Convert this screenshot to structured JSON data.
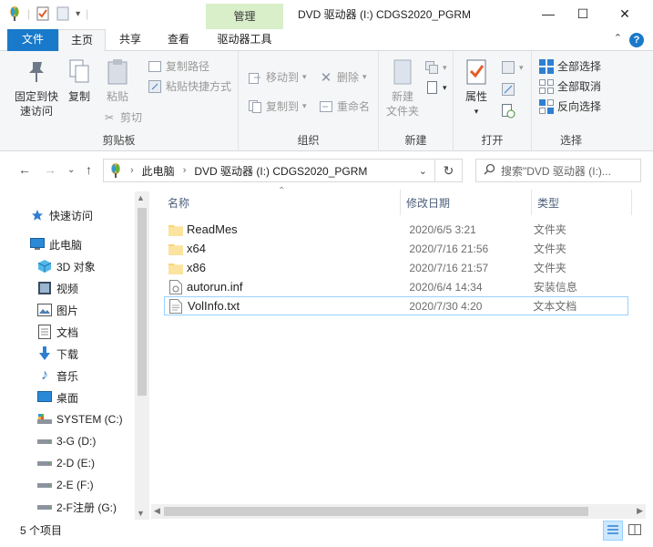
{
  "window": {
    "title": "DVD 驱动器 (I:) CDGS2020_PGRM",
    "context_tab_group": "管理",
    "controls": {
      "minimize": "—",
      "maximize": "☐",
      "close": "✕"
    }
  },
  "tabs": [
    "文件",
    "主页",
    "共享",
    "查看",
    "驱动器工具"
  ],
  "help_label": "?",
  "ribbon": {
    "clipboard": {
      "label": "剪贴板",
      "pin": "固定到快\n速访问",
      "copy": "复制",
      "paste": "粘贴",
      "copy_path": "复制路径",
      "paste_shortcut": "粘贴快捷方式",
      "cut": "剪切"
    },
    "organize": {
      "label": "组织",
      "move_to": "移动到",
      "copy_to": "复制到",
      "delete": "删除",
      "rename": "重命名"
    },
    "new": {
      "label": "新建",
      "new_folder": "新建\n文件夹"
    },
    "open": {
      "label": "打开",
      "properties": "属性"
    },
    "select": {
      "label": "选择",
      "select_all": "全部选择",
      "select_none": "全部取消",
      "invert": "反向选择"
    }
  },
  "address": {
    "crumbs": [
      "此电脑",
      "DVD 驱动器 (I:) CDGS2020_PGRM"
    ],
    "search_placeholder": "搜索\"DVD 驱动器 (I:)..."
  },
  "nav": {
    "quick_access": "快速访问",
    "this_pc": "此电脑",
    "items": [
      {
        "label": "3D 对象",
        "icon": "cube-icon"
      },
      {
        "label": "视频",
        "icon": "video-icon"
      },
      {
        "label": "图片",
        "icon": "pictures-icon"
      },
      {
        "label": "文档",
        "icon": "documents-icon"
      },
      {
        "label": "下载",
        "icon": "download-icon"
      },
      {
        "label": "音乐",
        "icon": "music-icon"
      },
      {
        "label": "桌面",
        "icon": "desktop-icon"
      },
      {
        "label": "SYSTEM (C:)",
        "icon": "system-drive-icon"
      },
      {
        "label": "3-G (D:)",
        "icon": "drive-icon"
      },
      {
        "label": "2-D (E:)",
        "icon": "drive-icon"
      },
      {
        "label": "2-E (F:)",
        "icon": "drive-icon"
      },
      {
        "label": "2-F注册 (G:)",
        "icon": "drive-icon"
      }
    ]
  },
  "columns": [
    "名称",
    "修改日期",
    "类型"
  ],
  "files": [
    {
      "name": "ReadMes",
      "date": "2020/6/5 3:21",
      "type": "文件夹",
      "icon": "folder-icon"
    },
    {
      "name": "x64",
      "date": "2020/7/16 21:56",
      "type": "文件夹",
      "icon": "folder-icon"
    },
    {
      "name": "x86",
      "date": "2020/7/16 21:57",
      "type": "文件夹",
      "icon": "folder-icon"
    },
    {
      "name": "autorun.inf",
      "date": "2020/6/4 14:34",
      "type": "安装信息",
      "icon": "inf-file-icon"
    },
    {
      "name": "VolInfo.txt",
      "date": "2020/7/30 4:20",
      "type": "文本文档",
      "icon": "text-file-icon",
      "selected": true
    }
  ],
  "status": {
    "item_count": "5 个项目"
  },
  "colors": {
    "accent": "#1979ca",
    "ribbon_bg": "#f5f6f7",
    "context_band": "#d8efc9",
    "folder": "#f8d775",
    "selection_border": "#99d1ff"
  }
}
